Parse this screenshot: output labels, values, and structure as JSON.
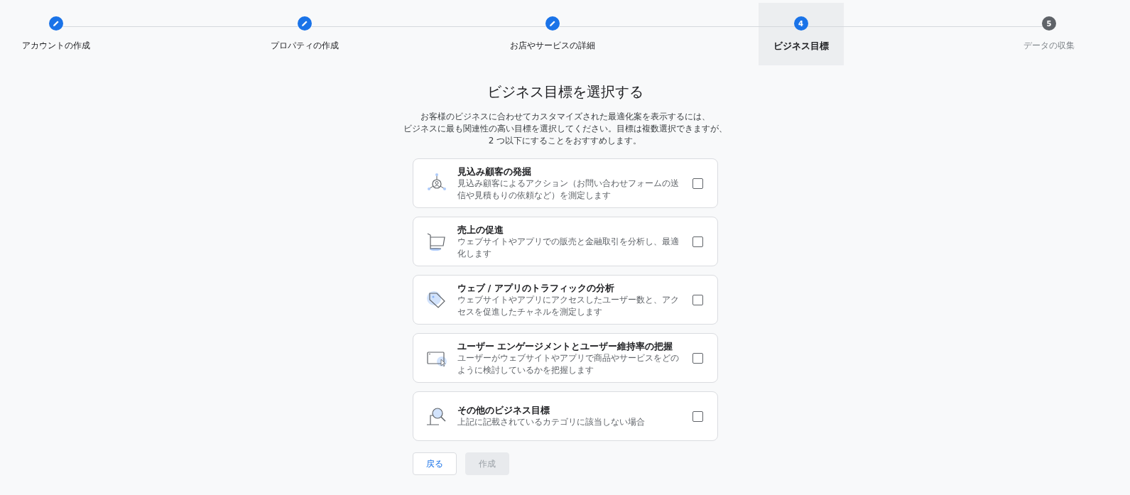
{
  "steps": [
    {
      "label": "アカウントの作成",
      "completed": true,
      "selected": false
    },
    {
      "label": "プロパティの作成",
      "completed": true,
      "selected": false
    },
    {
      "label": "お店やサービスの詳細",
      "completed": true,
      "selected": false
    },
    {
      "label": "ビジネス目標",
      "completed": false,
      "selected": true,
      "number": "4"
    },
    {
      "label": "データの収集",
      "completed": false,
      "selected": false,
      "number": "5"
    }
  ],
  "heading": "ビジネス目標を選択する",
  "intro": [
    "お客様のビジネスに合わせてカスタマイズされた最適化案を表示するには、",
    "ビジネスに最も関連性の高い目標を選択してください。目標は複数選択できますが、",
    "2 つ以下にすることをおすすめします。"
  ],
  "goals": [
    {
      "kind": "leads",
      "title": "見込み顧客の発掘",
      "description": "見込み顧客によるアクション（お問い合わせフォームの送信や見積もりの依頼など）を測定します",
      "checked": false
    },
    {
      "kind": "sales",
      "title": "売上の促進",
      "description": "ウェブサイトやアプリでの販売と金融取引を分析し、最適化します",
      "checked": false
    },
    {
      "kind": "traffic",
      "title": "ウェブ / アプリのトラフィックの分析",
      "description": "ウェブサイトやアプリにアクセスしたユーザー数と、アクセスを促進したチャネルを測定します",
      "checked": false
    },
    {
      "kind": "engagement",
      "title": "ユーザー エンゲージメントとユーザー維持率の把握",
      "description": "ユーザーがウェブサイトやアプリで商品やサービスをどのように検討しているかを把握します",
      "checked": false
    },
    {
      "kind": "other",
      "title": "その他のビジネス目標",
      "description": "上記に記載されているカテゴリに該当しない場合",
      "checked": false
    }
  ],
  "buttons": [
    {
      "label": "戻る",
      "disabled": false
    },
    {
      "label": "作成",
      "disabled": true
    }
  ]
}
